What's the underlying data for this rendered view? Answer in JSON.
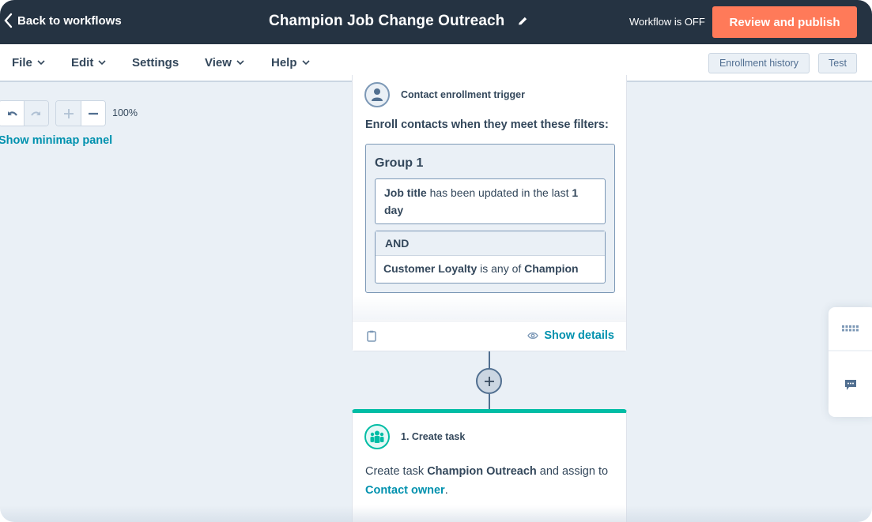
{
  "header": {
    "back_label": "Back to workflows",
    "title": "Champion Job Change Outreach",
    "status": "Workflow is OFF",
    "publish_label": "Review and publish",
    "accent_color": "#ff7a59"
  },
  "menu": {
    "items": [
      {
        "label": "File",
        "has_caret": true
      },
      {
        "label": "Edit",
        "has_caret": true
      },
      {
        "label": "Settings",
        "has_caret": false
      },
      {
        "label": "View",
        "has_caret": true
      },
      {
        "label": "Help",
        "has_caret": true
      }
    ],
    "enrollment_history_label": "Enrollment history",
    "test_label": "Test"
  },
  "canvas_controls": {
    "undo_icon": "undo-icon",
    "redo_icon": "redo-icon",
    "zoom_in_icon": "plus-icon",
    "zoom_out_icon": "minus-icon",
    "zoom_level": "100%",
    "minimap_label": "Show minimap panel"
  },
  "trigger": {
    "type_label": "Contact enrollment trigger",
    "intro": "Enroll contacts when they meet these filters:",
    "group_title": "Group 1",
    "filters": [
      {
        "property": "Job title",
        "operator": "has been updated in the last",
        "value": "1 day"
      },
      {
        "connector": "AND",
        "property": "Customer Loyalty",
        "operator": "is any of",
        "value": "Champion"
      }
    ],
    "show_details_label": "Show details"
  },
  "actions": [
    {
      "title": "1. Create task",
      "desc_prefix": "Create task",
      "task_name": "Champion Outreach",
      "desc_middle": "and assign to",
      "assignee": "Contact owner",
      "desc_suffix": ".",
      "accent_color": "#00bda5"
    }
  ],
  "side_rail": {
    "items": [
      "grid-dots-icon",
      "chat-icon"
    ]
  }
}
